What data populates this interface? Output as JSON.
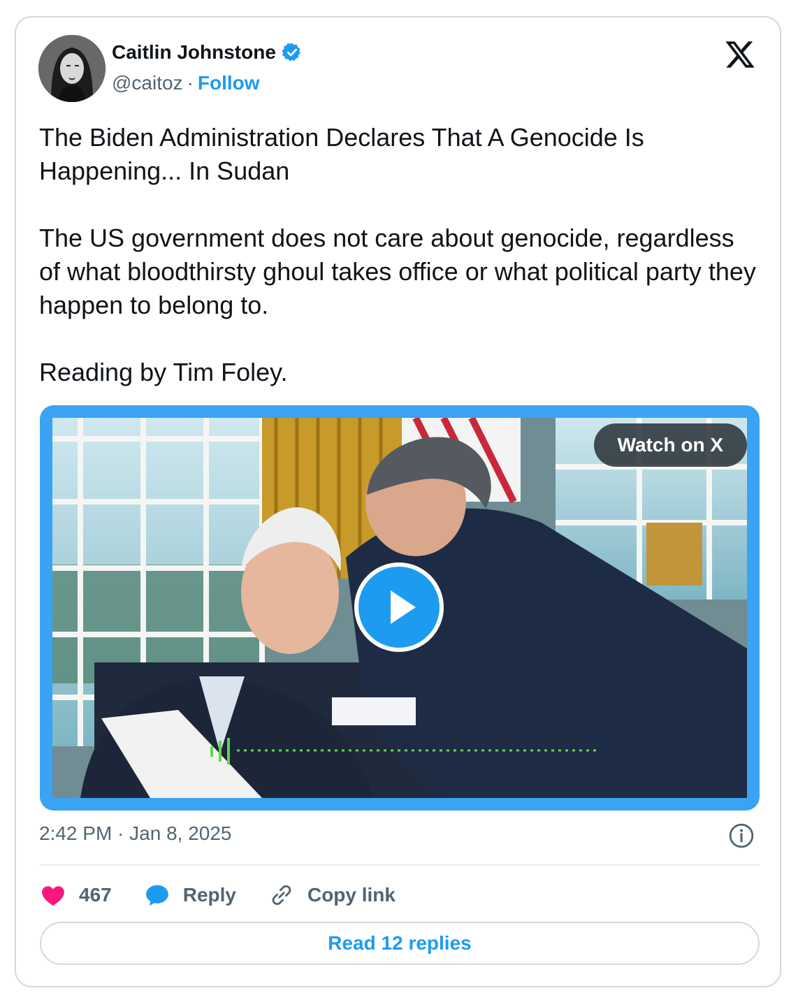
{
  "author": {
    "name": "Caitlin Johnstone",
    "handle": "@caitoz",
    "separator": "·",
    "follow_label": "Follow",
    "verified": true
  },
  "tweet": {
    "paragraphs": [
      "The Biden Administration Declares That A Genocide Is Happening... In Sudan",
      "The US government does not care about genocide, regardless of what bloodthirsty ghoul takes office or what political party they happen to belong to.",
      "Reading by Tim Foley."
    ]
  },
  "media": {
    "watch_label": "Watch on X",
    "play_icon": "play-icon"
  },
  "meta": {
    "timestamp": "2:42 PM · Jan 8, 2025"
  },
  "actions": {
    "like_count": "467",
    "reply_label": "Reply",
    "copy_label": "Copy link"
  },
  "read_replies_label": "Read 12 replies",
  "colors": {
    "accent": "#1d9bf0",
    "like": "#f91880",
    "text_secondary": "#536471",
    "border": "#cfd9de"
  }
}
